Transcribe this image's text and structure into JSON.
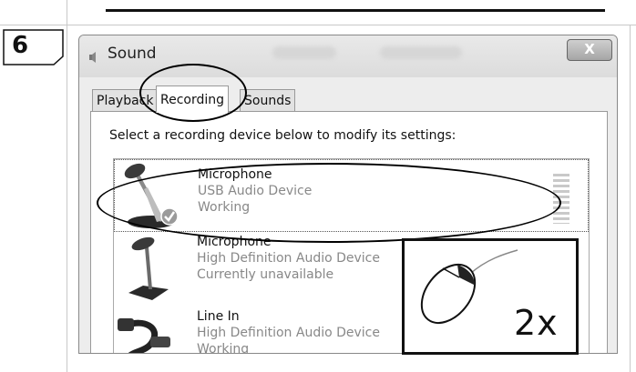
{
  "step": {
    "number": "6"
  },
  "window": {
    "title": "Sound",
    "close_label": "X"
  },
  "tabs": [
    {
      "label": "Playback"
    },
    {
      "label": "Recording",
      "active": true
    },
    {
      "label": "Sounds"
    }
  ],
  "instruction": "Select a recording device below to modify its settings:",
  "devices": [
    {
      "name": "Microphone",
      "device": "USB Audio Device",
      "status": "Working",
      "selected": true,
      "icon": "microphone-icon"
    },
    {
      "name": "Microphone",
      "device": "High Definition Audio Device",
      "status": "Currently unavailable",
      "icon": "microphone-icon"
    },
    {
      "name": "Line In",
      "device": "High Definition Audio Device",
      "status": "Working",
      "icon": "line-in-cable-icon"
    }
  ],
  "callout": {
    "click_count": "2x",
    "icon": "mouse-icon"
  }
}
